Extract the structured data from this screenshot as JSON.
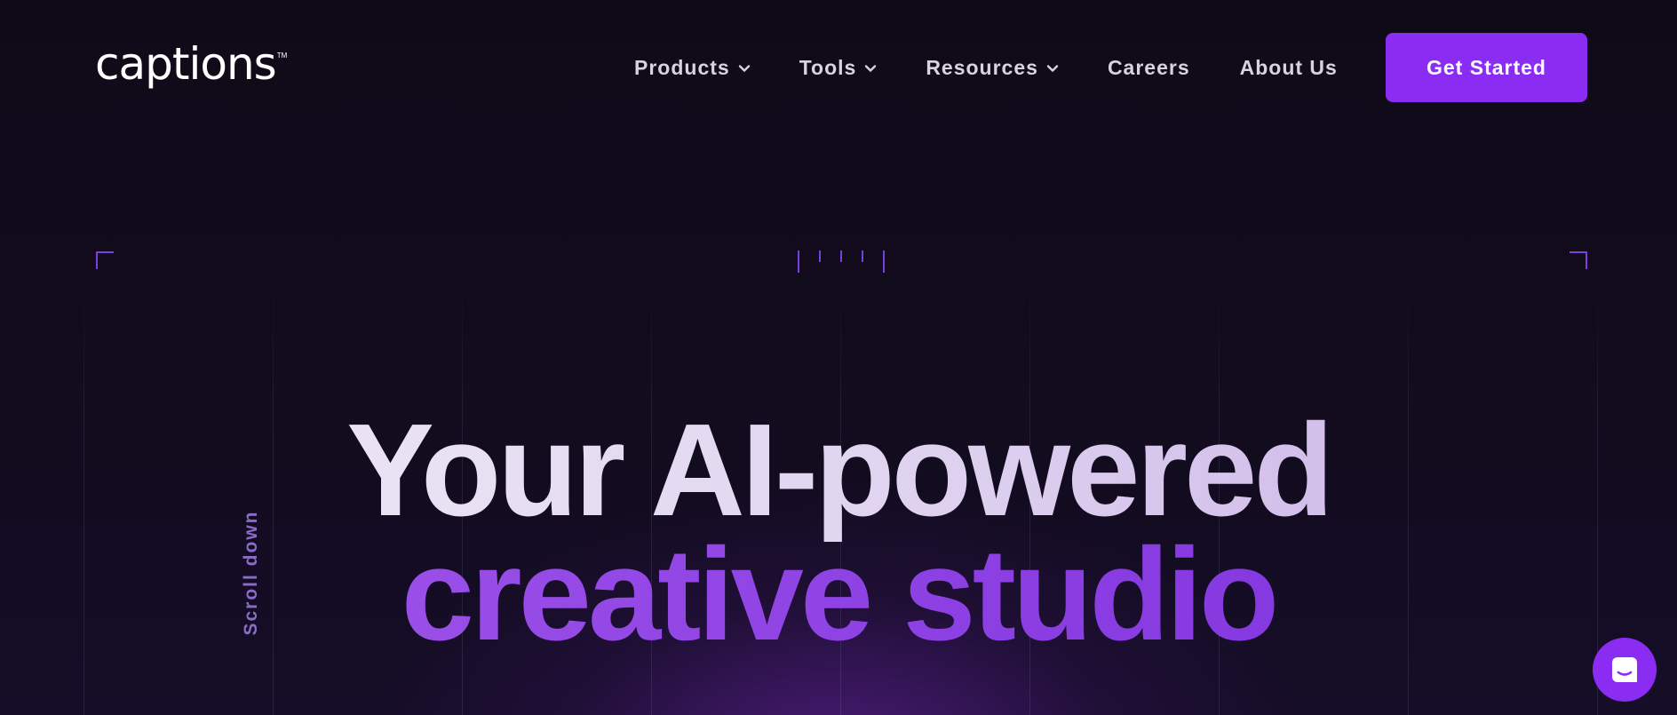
{
  "brand": {
    "name": "captions",
    "trademark": "TM",
    "accent_color": "#8a2cf2"
  },
  "nav": {
    "products": "Products",
    "tools": "Tools",
    "resources": "Resources",
    "careers": "Careers",
    "about": "About Us",
    "cta": "Get Started",
    "dropdown_icon": "chevron-down-icon"
  },
  "hero": {
    "line1": "Your AI-powered",
    "line2": "creative studio",
    "scroll_hint": "Scroll down"
  },
  "chat_widget": {
    "icon": "chat-icon"
  }
}
